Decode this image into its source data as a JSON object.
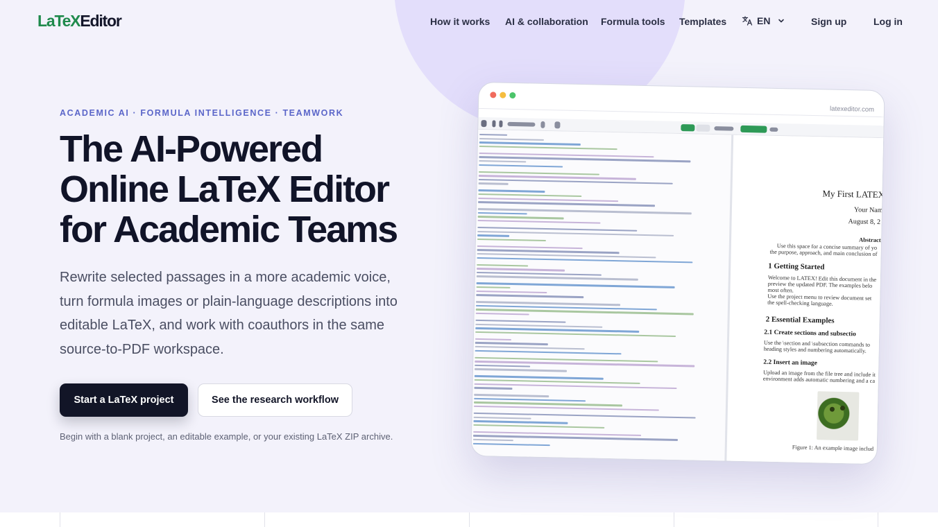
{
  "brand": {
    "part1": "LaTeX",
    "part2": "Editor"
  },
  "nav": {
    "links": [
      "How it works",
      "AI & collaboration",
      "Formula tools",
      "Templates"
    ],
    "language": "EN",
    "signup": "Sign up",
    "login": "Log in"
  },
  "hero": {
    "eyebrow": "ACADEMIC AI · FORMULA INTELLIGENCE · TEAMWORK",
    "headline": "The AI-Powered Online LaTeX Editor for Academic Teams",
    "lead": "Rewrite selected passages in a more academic voice, turn formula images or plain-language descriptions into editable LaTeX, and work with coauthors in the same source-to-PDF workspace.",
    "cta_primary": "Start a LaTeX project",
    "cta_secondary": "See the research workflow",
    "note": "Begin with a blank project, an editable example, or your existing LaTeX ZIP archive."
  },
  "mockup": {
    "url": "latexeditor.com",
    "pdf": {
      "title": "My First LATEX",
      "author": "Your Nam",
      "date": "August 8, 2",
      "abstract_heading": "Abstract",
      "abstract_lines": [
        "Use this space for a concise summary of yo",
        "the purpose, approach, and main conclusion of"
      ],
      "s1": "1   Getting Started",
      "s1_lines": [
        "Welcome to LATEX!  Edit this document in the",
        "preview the updated PDF.  The examples belo",
        "most often.",
        "    Use the project menu to review document set",
        "the spell-checking language."
      ],
      "s2": "2   Essential Examples",
      "s21": "2.1   Create sections and subsectio",
      "s21_lines": [
        "Use the \\section and \\subsection commands to",
        "heading styles and numbering automatically."
      ],
      "s22": "2.2   Insert an image",
      "s22_lines": [
        "Upload an image from the file tree and include it",
        "environment adds automatic numbering and a ca"
      ],
      "caption": "Figure 1:  An example image includ"
    }
  },
  "colors": {
    "accent": "#5b66c9",
    "brand_green": "#1f8a4c",
    "dark": "#121527",
    "background": "#f3f2fb",
    "blob": "#e3defb"
  }
}
